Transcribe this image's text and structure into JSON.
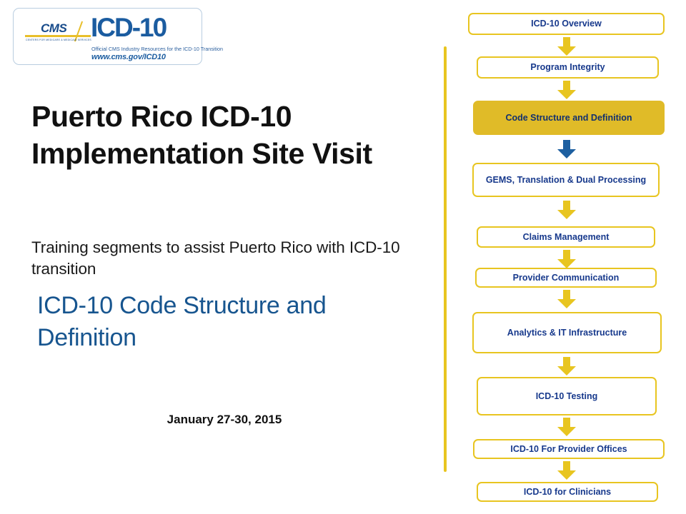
{
  "logo": {
    "name": "cms-icd10-logo",
    "cms_word": "CMS",
    "cms_subtext": "CENTERS FOR MEDICARE & MEDICAID SERVICES",
    "icd10_word": "ICD-10",
    "tagline": "Official CMS Industry Resources for the ICD-10 Transition",
    "url": "www.cms.gov/ICD10"
  },
  "slide": {
    "title": "Puerto Rico ICD-10 Implementation Site Visit",
    "subtitle": "Training segments to assist Puerto Rico with ICD-10 transition",
    "section_heading": "ICD-10 Code Structure and Definition",
    "date": "January 27-30, 2015"
  },
  "colors": {
    "gold": "#e8c520",
    "highlight_fill": "#e0bb28",
    "flow_text_blue": "#17398c",
    "heading_blue": "#17558f",
    "accent_arrow_blue": "#1d5fa0"
  },
  "flowchart": {
    "name": "training-segments-flow",
    "steps": [
      {
        "label": "ICD-10 Overview",
        "highlight": false
      },
      {
        "label": "Program Integrity",
        "highlight": false
      },
      {
        "label": "Code Structure and Definition",
        "highlight": true
      },
      {
        "label": "GEMS, Translation & Dual Processing",
        "highlight": false
      },
      {
        "label": "Claims Management",
        "highlight": false
      },
      {
        "label": "Provider Communication",
        "highlight": false
      },
      {
        "label": "Analytics & IT Infrastructure",
        "highlight": false
      },
      {
        "label": "ICD-10 Testing",
        "highlight": false
      },
      {
        "label": "ICD-10 For Provider Offices",
        "highlight": false
      },
      {
        "label": "ICD-10 for Clinicians",
        "highlight": false
      }
    ],
    "connectors": [
      {
        "from": 0,
        "to": 1,
        "color": "gold"
      },
      {
        "from": 1,
        "to": 2,
        "color": "gold"
      },
      {
        "from": 2,
        "to": 3,
        "color": "blue"
      },
      {
        "from": 3,
        "to": 4,
        "color": "gold"
      },
      {
        "from": 4,
        "to": 5,
        "color": "gold"
      },
      {
        "from": 5,
        "to": 6,
        "color": "gold"
      },
      {
        "from": 6,
        "to": 7,
        "color": "gold"
      },
      {
        "from": 7,
        "to": 8,
        "color": "gold"
      },
      {
        "from": 8,
        "to": 9,
        "color": "gold"
      }
    ]
  }
}
